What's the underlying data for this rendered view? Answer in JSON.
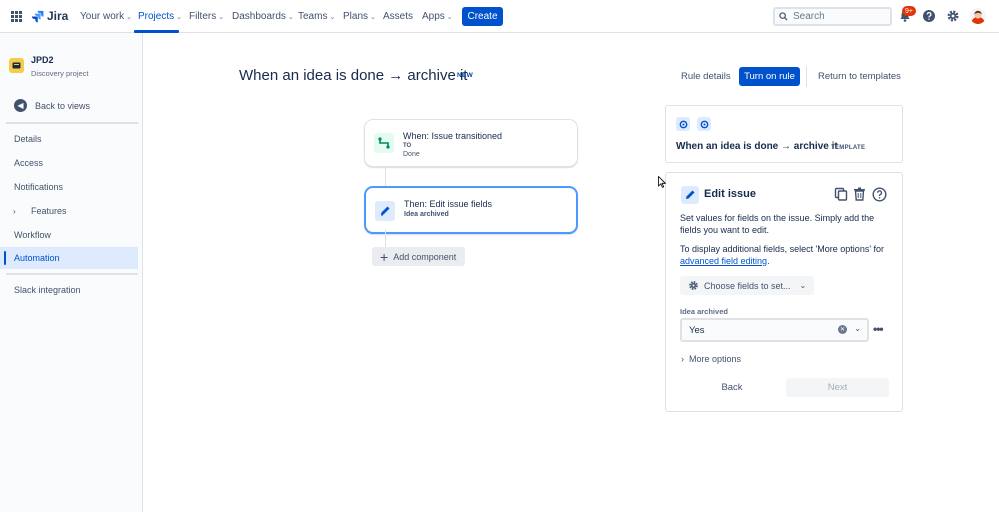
{
  "topnav": {
    "brand": "Jira",
    "items": [
      {
        "label": "Your work",
        "dropdown": true
      },
      {
        "label": "Projects",
        "dropdown": true,
        "active": true
      },
      {
        "label": "Filters",
        "dropdown": true
      },
      {
        "label": "Dashboards",
        "dropdown": true
      },
      {
        "label": "Teams",
        "dropdown": true
      },
      {
        "label": "Plans",
        "dropdown": true
      },
      {
        "label": "Assets",
        "dropdown": false
      },
      {
        "label": "Apps",
        "dropdown": true
      }
    ],
    "create_label": "Create",
    "search_placeholder": "Search",
    "notifications_badge": "9+",
    "icons": [
      "app-switcher-icon",
      "jira-logo-icon",
      "search-icon",
      "bell-icon",
      "help-icon",
      "settings-icon",
      "avatar"
    ]
  },
  "sidebar": {
    "project_name": "JPD2",
    "project_type": "Discovery project",
    "back_label": "Back to views",
    "items": [
      {
        "label": "Details"
      },
      {
        "label": "Access"
      },
      {
        "label": "Notifications"
      },
      {
        "label": "Features",
        "expandable": true
      },
      {
        "label": "Workflow"
      },
      {
        "label": "Automation",
        "active": true
      }
    ],
    "bottom_items": [
      {
        "label": "Slack integration"
      }
    ]
  },
  "header": {
    "title": "When an idea is done → archive it",
    "lozenge": "NEW",
    "rule_details_label": "Rule details",
    "turn_on_label": "Turn on rule",
    "return_label": "Return to templates"
  },
  "rule": {
    "trigger": {
      "title": "When: Issue transitioned",
      "sub_label": "TO",
      "sub_value": "Done"
    },
    "action": {
      "title": "Then: Edit issue fields",
      "sub": "Idea archived"
    },
    "add_component_label": "Add component"
  },
  "template_panel": {
    "title": "When an idea is done → archive it",
    "tag": "TEMPLATE"
  },
  "edit_panel": {
    "title": "Edit issue",
    "desc1": "Set values for fields on the issue. Simply add the fields you want to edit.",
    "desc2_prefix": "To display additional fields, select 'More options' for ",
    "desc2_link": "advanced field editing",
    "desc2_suffix": ".",
    "choose_label": "Choose fields to set...",
    "field_label": "Idea archived",
    "field_value": "Yes",
    "more_options_label": "More options",
    "back_label": "Back",
    "next_label": "Next"
  },
  "colors": {
    "primary": "#0052CC",
    "trigger_icon_bg": "#E3FCEF",
    "trigger_icon": "#00875A",
    "action_icon_bg": "#DEEBFF",
    "action_icon": "#0052CC",
    "badge": "#DE350B"
  }
}
